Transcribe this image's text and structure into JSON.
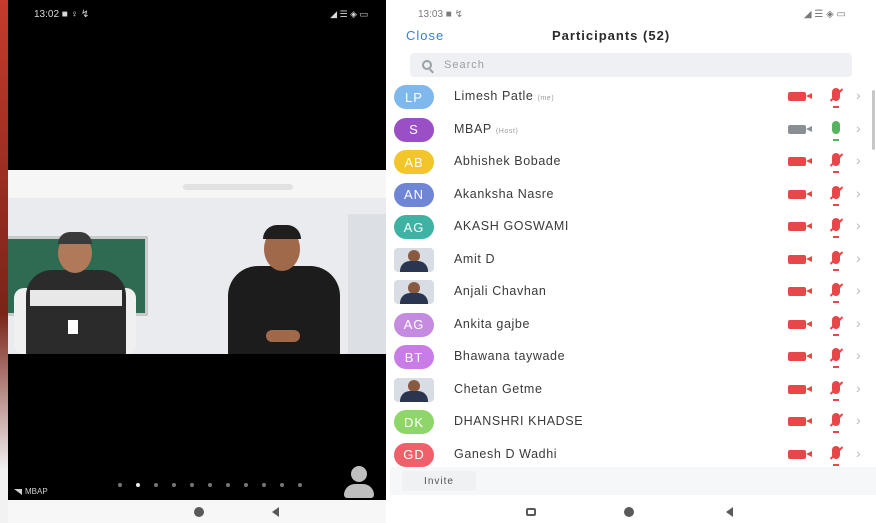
{
  "left_screen": {
    "status_time": "13:02 ■ ♀ ↯",
    "status_icons": "◢ ☰ ◈ ▭",
    "speaker_name": "MBAP"
  },
  "right_screen": {
    "status_time": "13:03 ■ ↯",
    "status_icons": "◢ ☰ ◈ ▭",
    "close_label": "Close",
    "title": "Participants (52)",
    "search_placeholder": "Search",
    "invite_label": "Invite",
    "participants": [
      {
        "initials": "LP",
        "name": "Limesh Patle",
        "tag": "(me)",
        "color": "#7fb8ec",
        "video_on": false,
        "audio_on": false
      },
      {
        "initials": "S",
        "name": "MBAP",
        "tag": "(Host)",
        "color": "#9a4fc4",
        "video_on": true,
        "audio_on": true
      },
      {
        "initials": "AB",
        "name": "Abhishek Bobade",
        "tag": "",
        "color": "#f2c52a",
        "video_on": false,
        "audio_on": false
      },
      {
        "initials": "AN",
        "name": "Akanksha Nasre",
        "tag": "",
        "color": "#6f86d6",
        "video_on": false,
        "audio_on": false
      },
      {
        "initials": "AG",
        "name": "AKASH GOSWAMI",
        "tag": "",
        "color": "#3fb3a3",
        "video_on": false,
        "audio_on": false
      },
      {
        "initials": "",
        "name": "Amit D",
        "tag": "",
        "color": "",
        "video_on": false,
        "audio_on": false,
        "photo": true
      },
      {
        "initials": "",
        "name": "Anjali Chavhan",
        "tag": "",
        "color": "",
        "video_on": false,
        "audio_on": false,
        "photo": true
      },
      {
        "initials": "AG",
        "name": "Ankita gajbe",
        "tag": "",
        "color": "#c48be0",
        "video_on": false,
        "audio_on": false
      },
      {
        "initials": "BT",
        "name": "Bhawana taywade",
        "tag": "",
        "color": "#c97be6",
        "video_on": false,
        "audio_on": false
      },
      {
        "initials": "",
        "name": "Chetan Getme",
        "tag": "",
        "color": "",
        "video_on": false,
        "audio_on": false,
        "photo": true
      },
      {
        "initials": "DK",
        "name": "DHANSHRI KHADSE",
        "tag": "",
        "color": "#8fd66a",
        "video_on": false,
        "audio_on": false
      },
      {
        "initials": "GD",
        "name": "Ganesh D Wadhi",
        "tag": "",
        "color": "#f0606a",
        "video_on": false,
        "audio_on": false
      }
    ]
  }
}
